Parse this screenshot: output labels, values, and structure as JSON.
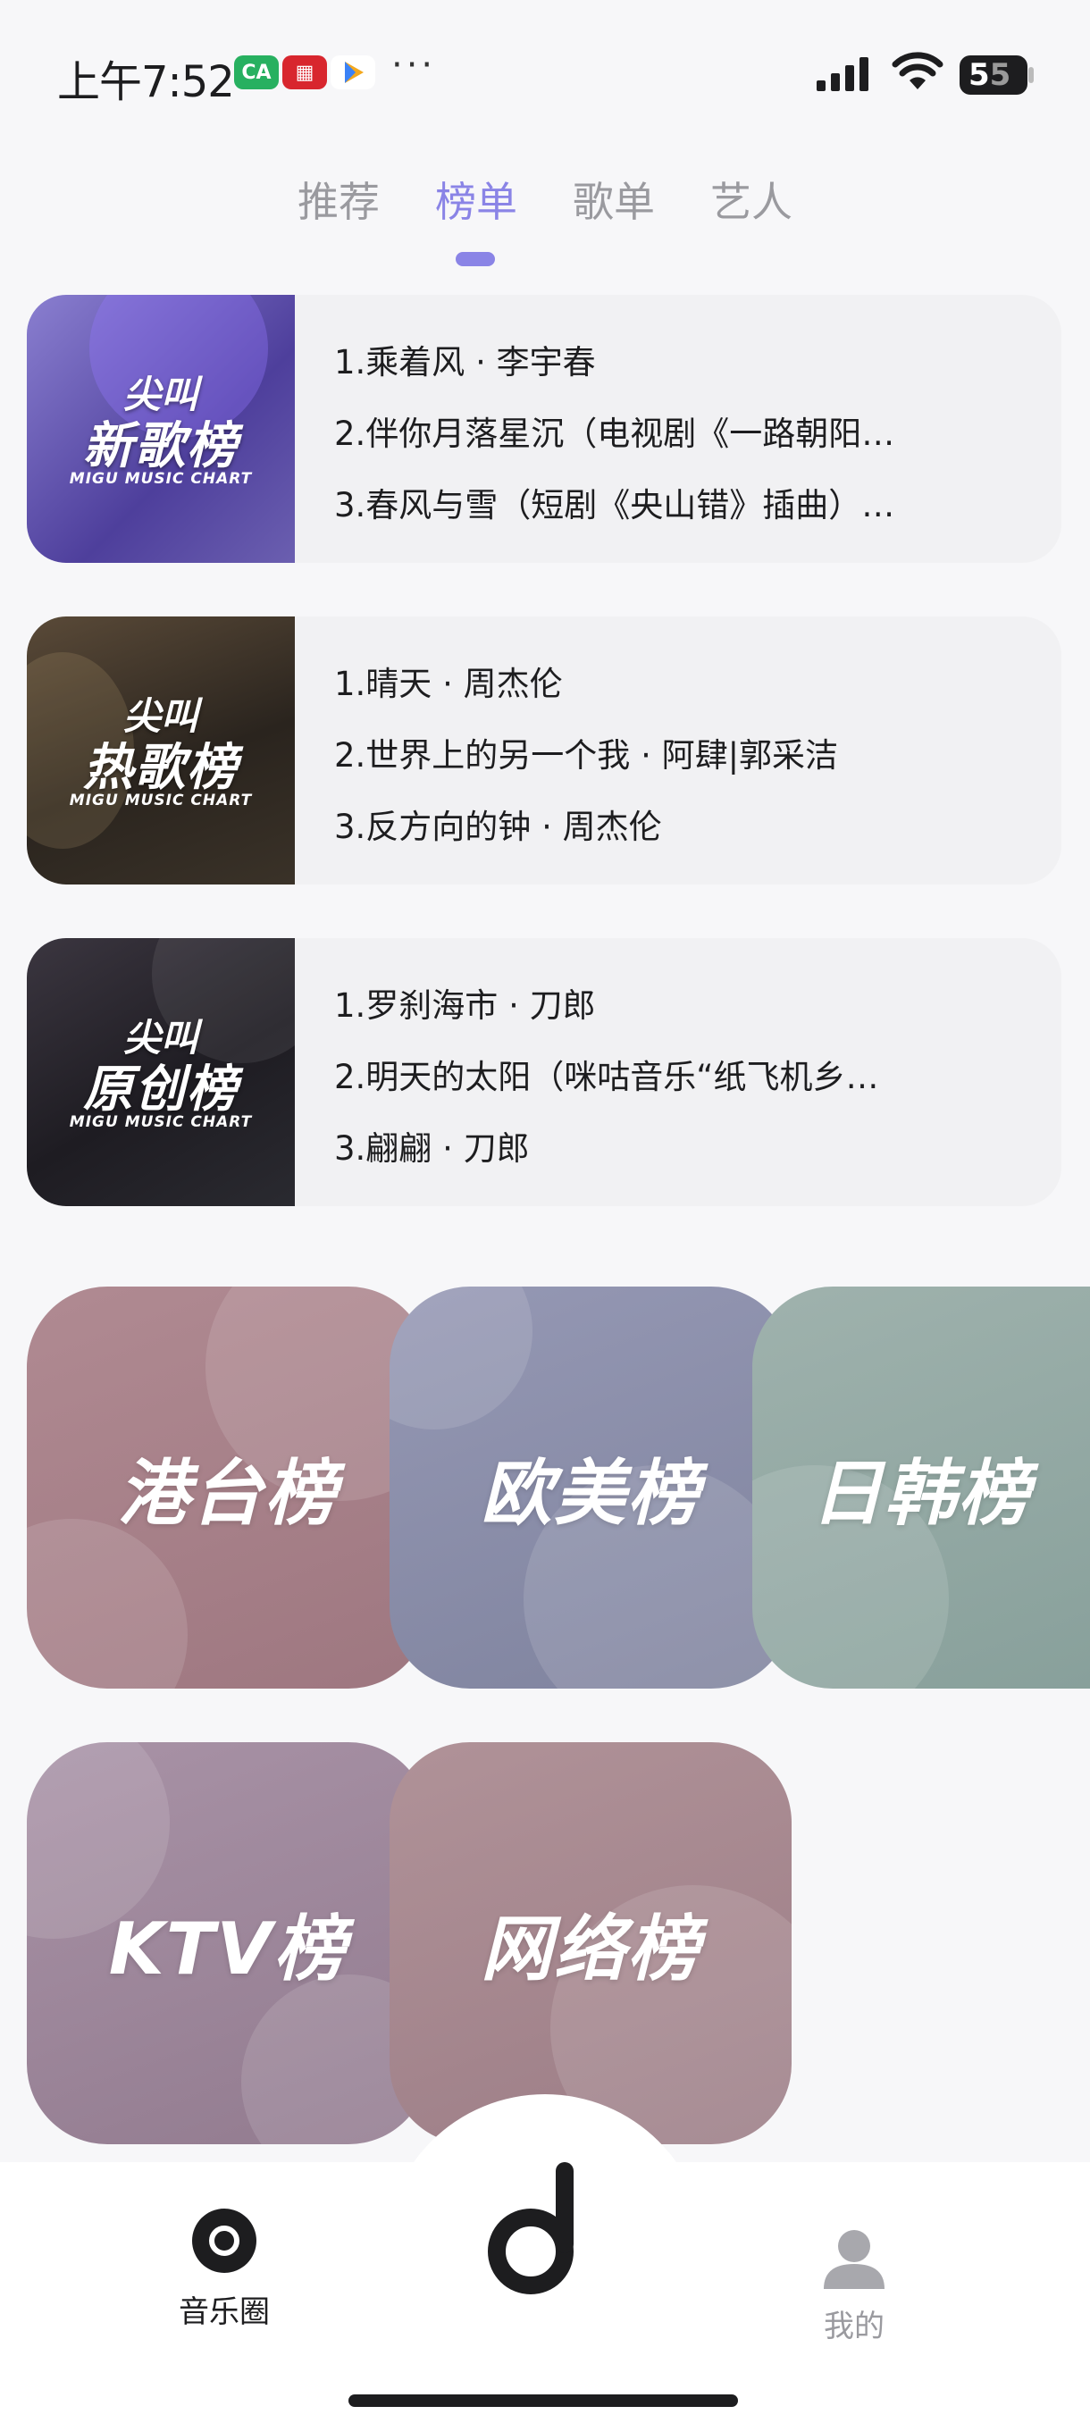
{
  "status_bar": {
    "time": "上午7:52",
    "battery": "55",
    "battery_first": "5",
    "battery_rest": "5",
    "app_icons": [
      "ca-app-icon",
      "migu-app-icon",
      "play-store-icon"
    ],
    "more": "···"
  },
  "tabs": [
    {
      "label": "推荐",
      "active": false
    },
    {
      "label": "榜单",
      "active": true
    },
    {
      "label": "歌单",
      "active": false
    },
    {
      "label": "艺人",
      "active": false
    }
  ],
  "charts": [
    {
      "cover_line1": "尖叫",
      "cover_line2": "新歌榜",
      "cover_sub": "MIGU MUSIC CHART",
      "cover_color": "#6b5fb0",
      "items": [
        "1.乘着风 · 李宇春",
        "2.伴你月落星沉（电视剧《一路朝阳…",
        "3.春风与雪（短剧《央山错》插曲）…"
      ]
    },
    {
      "cover_line1": "尖叫",
      "cover_line2": "热歌榜",
      "cover_sub": "MIGU MUSIC CHART",
      "cover_color": "#3a3228",
      "items": [
        "1.晴天 · 周杰伦",
        "2.世界上的另一个我 · 阿肆|郭采洁",
        "3.反方向的钟 · 周杰伦"
      ]
    },
    {
      "cover_line1": "尖叫",
      "cover_line2": "原创榜",
      "cover_sub": "MIGU MUSIC CHART",
      "cover_color": "#2a2a30",
      "items": [
        "1.罗刹海市 · 刀郎",
        "2.明天的太阳（咪咕音乐“纸飞机乡…",
        "3.翩翩 · 刀郎"
      ]
    }
  ],
  "categories": [
    {
      "label": "港台榜",
      "color": "#a9808a"
    },
    {
      "label": "欧美榜",
      "color": "#8c8fab"
    },
    {
      "label": "日韩榜",
      "color": "#94aaa6"
    },
    {
      "label": "KTV榜",
      "color": "#9e8597"
    },
    {
      "label": "网络榜",
      "color": "#a88990"
    }
  ],
  "bottom_nav": {
    "left_label": "音乐圈",
    "right_label": "我的",
    "center_icon": "music-note-icon"
  }
}
